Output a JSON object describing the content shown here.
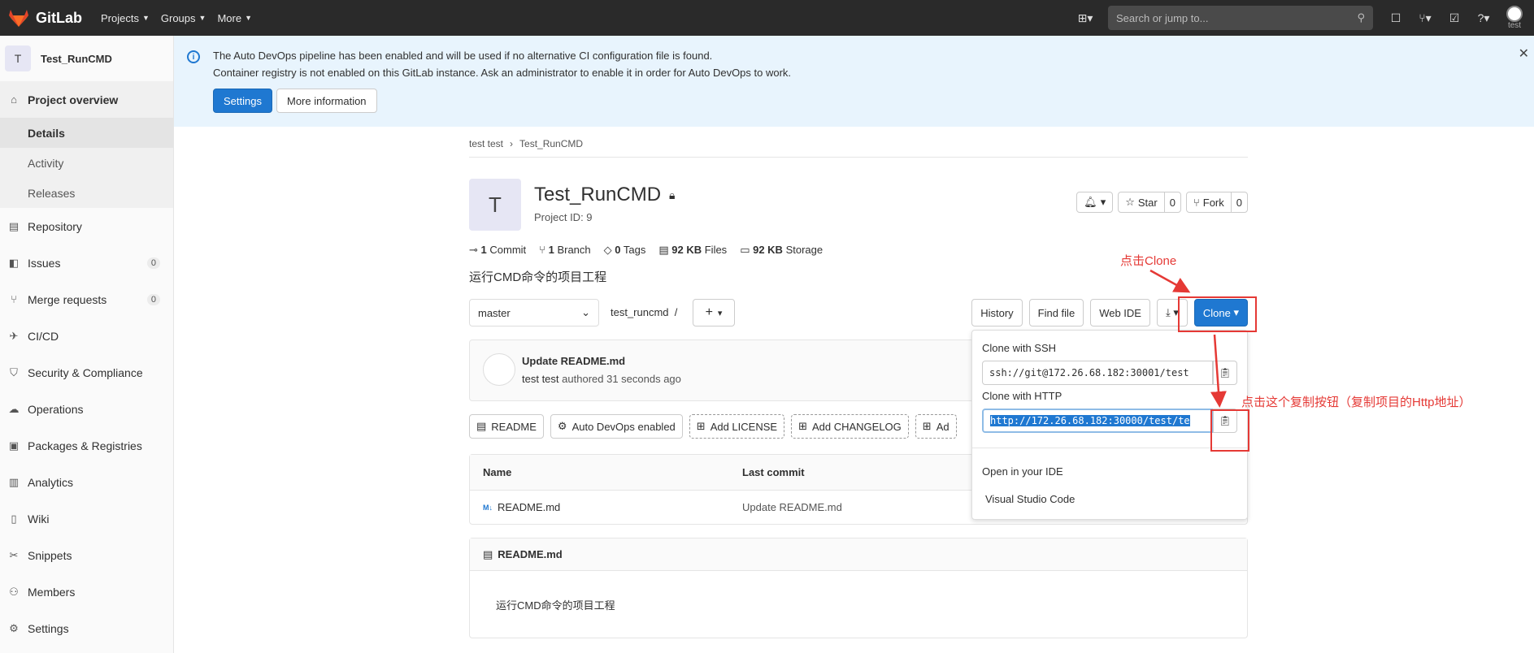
{
  "topbar": {
    "brand": "GitLab",
    "nav": [
      "Projects",
      "Groups",
      "More"
    ],
    "search_placeholder": "Search or jump to...",
    "user": "test"
  },
  "sidebar": {
    "project_initial": "T",
    "project_name": "Test_RunCMD",
    "items": [
      {
        "label": "Project overview",
        "icon": "home-icon"
      },
      {
        "label": "Repository",
        "icon": "doc-icon"
      },
      {
        "label": "Issues",
        "icon": "issues-icon",
        "count": "0"
      },
      {
        "label": "Merge requests",
        "icon": "merge-icon",
        "count": "0"
      },
      {
        "label": "CI/CD",
        "icon": "rocket-icon"
      },
      {
        "label": "Security & Compliance",
        "icon": "shield-icon"
      },
      {
        "label": "Operations",
        "icon": "cloud-icon"
      },
      {
        "label": "Packages & Registries",
        "icon": "package-icon"
      },
      {
        "label": "Analytics",
        "icon": "chart-icon"
      },
      {
        "label": "Wiki",
        "icon": "book-icon"
      },
      {
        "label": "Snippets",
        "icon": "scissors-icon"
      },
      {
        "label": "Members",
        "icon": "users-icon"
      },
      {
        "label": "Settings",
        "icon": "gear-icon"
      }
    ],
    "subitems": [
      "Details",
      "Activity",
      "Releases"
    ]
  },
  "alert": {
    "line1": "The Auto DevOps pipeline has been enabled and will be used if no alternative CI configuration file is found.",
    "line2": "Container registry is not enabled on this GitLab instance. Ask an administrator to enable it in order for Auto DevOps to work.",
    "settings_btn": "Settings",
    "more_btn": "More information"
  },
  "breadcrumb": [
    "test test",
    "Test_RunCMD"
  ],
  "project": {
    "initial": "T",
    "title": "Test_RunCMD",
    "id_text": "Project ID: 9",
    "star_label": "Star",
    "star_count": "0",
    "fork_label": "Fork",
    "fork_count": "0",
    "description": "运行CMD命令的项目工程"
  },
  "stats": [
    {
      "num": "1",
      "label": "Commit"
    },
    {
      "num": "1",
      "label": "Branch"
    },
    {
      "num": "0",
      "label": "Tags"
    },
    {
      "num": "92 KB",
      "label": "Files"
    },
    {
      "num": "92 KB",
      "label": "Storage"
    }
  ],
  "branch": {
    "selected": "master",
    "path": "test_runcmd",
    "path_sep": "/",
    "buttons": [
      "History",
      "Find file",
      "Web IDE"
    ],
    "clone_label": "Clone"
  },
  "commit": {
    "title": "Update README.md",
    "author": "test test",
    "meta": "authored 31 seconds ago"
  },
  "badges": [
    "README",
    "Auto DevOps enabled",
    "Add LICENSE",
    "Add CHANGELOG",
    "Ad"
  ],
  "table": {
    "headers": [
      "Name",
      "Last commit"
    ],
    "rows": [
      {
        "name": "README.md",
        "commit": "Update README.md"
      }
    ]
  },
  "readme": {
    "filename": "README.md",
    "body": "运行CMD命令的项目工程"
  },
  "clone_dropdown": {
    "ssh_label": "Clone with SSH",
    "ssh_value": "ssh://git@172.26.68.182:30001/test",
    "http_label": "Clone with HTTP",
    "http_value": "http://172.26.68.182:30000/test/te",
    "ide_title": "Open in your IDE",
    "ide_item": "Visual Studio Code"
  },
  "annotations": {
    "clone_hint": "点击Clone",
    "copy_hint": "点击这个复制按钮（复制项目的Http地址）",
    "color": "#e53935"
  }
}
